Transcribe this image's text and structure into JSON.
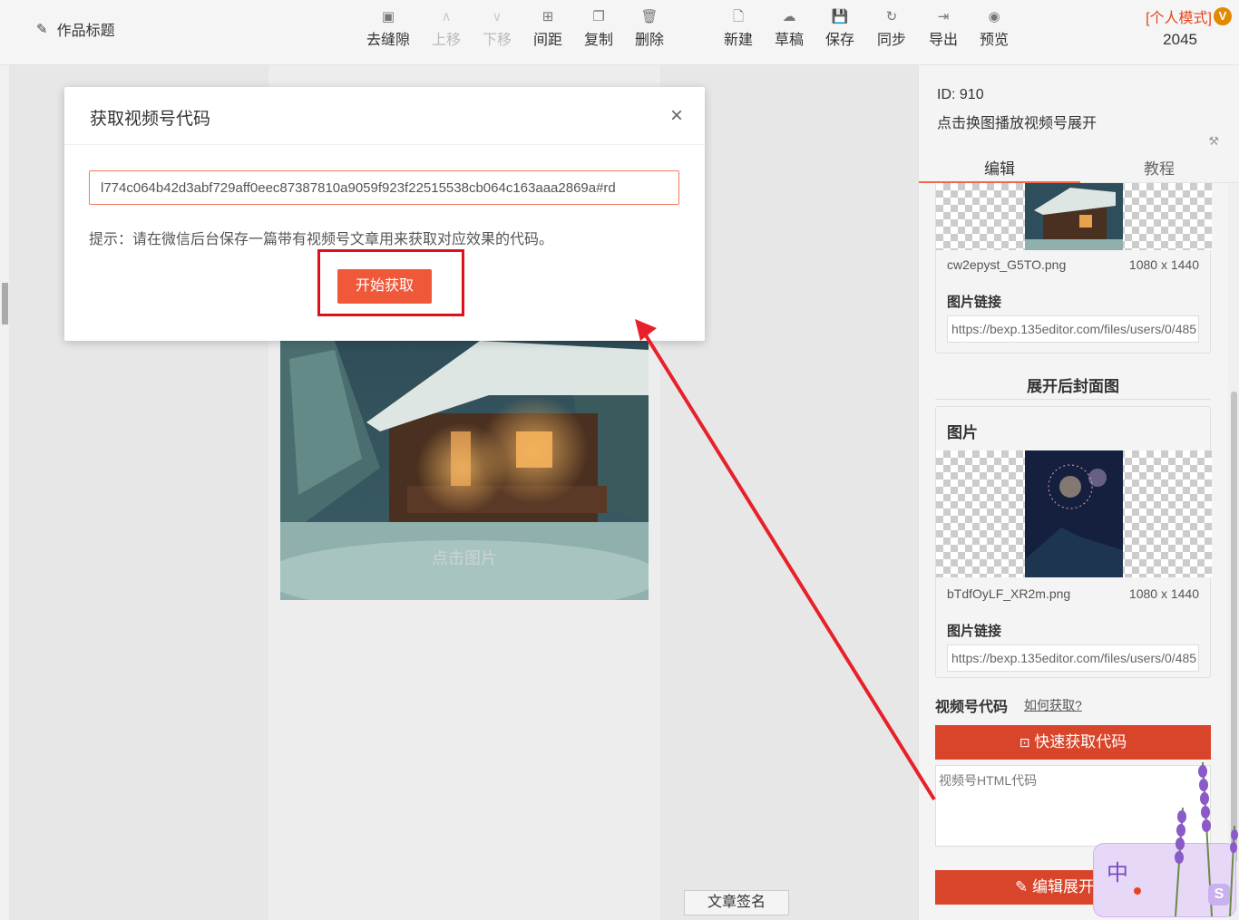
{
  "header": {
    "work_title": "作品标题",
    "tools": [
      {
        "label": "去缝隙",
        "icon": "gap-icon",
        "glyph": "▣",
        "disabled": false
      },
      {
        "label": "上移",
        "icon": "up-icon",
        "glyph": "∧",
        "disabled": true
      },
      {
        "label": "下移",
        "icon": "down-icon",
        "glyph": "∨",
        "disabled": true
      },
      {
        "label": "间距",
        "icon": "spacing-icon",
        "glyph": "⊞",
        "disabled": false
      },
      {
        "label": "复制",
        "icon": "copy-icon",
        "glyph": "❐",
        "disabled": false
      },
      {
        "label": "删除",
        "icon": "trash-icon",
        "glyph": "🗑",
        "disabled": false
      },
      {
        "label": "新建",
        "icon": "new-file-icon",
        "glyph": "🗋",
        "disabled": false
      },
      {
        "label": "草稿",
        "icon": "cloud-icon",
        "glyph": "☁",
        "disabled": false
      },
      {
        "label": "保存",
        "icon": "save-icon",
        "glyph": "💾",
        "disabled": false
      },
      {
        "label": "同步",
        "icon": "sync-icon",
        "glyph": "↻",
        "disabled": false
      },
      {
        "label": "导出",
        "icon": "export-icon",
        "glyph": "⇥",
        "disabled": false
      },
      {
        "label": "预览",
        "icon": "eye-icon",
        "glyph": "◉",
        "disabled": false
      }
    ],
    "mode_label": "[个人模式]",
    "vip_badge": "V",
    "count": "2045"
  },
  "canvas": {
    "image_caption": "点击图片",
    "signature_button": "文章签名"
  },
  "modal": {
    "title": "获取视频号代码",
    "close_glyph": "×",
    "code_value": "l774c064b42d3abf729aff0eec87387810a9059f923f22515538cb064c163aaa2869a#rd",
    "hint": "提示：请在微信后台保存一篇带有视频号文章用来获取对应效果的代码。",
    "start_button": "开始获取"
  },
  "right_panel": {
    "id_text": "ID: 910",
    "component_name": "点击换图播放视频号展开",
    "tabs": [
      "编辑",
      "教程"
    ],
    "image1": {
      "filename": "cw2epyst_G5TO.png",
      "size": "1080 x 1440",
      "link_label": "图片链接",
      "link_value": "https://bexp.135editor.com/files/users/0/485"
    },
    "expanded_cover_title": "展开后封面图",
    "image2": {
      "card_title": "图片",
      "filename": "bTdfOyLF_XR2m.png",
      "size": "1080 x 1440",
      "link_label": "图片链接",
      "link_value": "https://bexp.135editor.com/files/users/0/485"
    },
    "video_code_label": "视频号代码",
    "how_to_get": "如何获取?",
    "quick_get_button": "快速获取代码",
    "code_placeholder": "视频号HTML代码",
    "edit_expand_button": "编辑展开"
  },
  "ime": {
    "zh": "中",
    "logo": "S"
  },
  "colors": {
    "accent": "#f0583a",
    "button_dark": "#d9452a",
    "highlight": "#e0101a",
    "mode": "#e8451e"
  }
}
